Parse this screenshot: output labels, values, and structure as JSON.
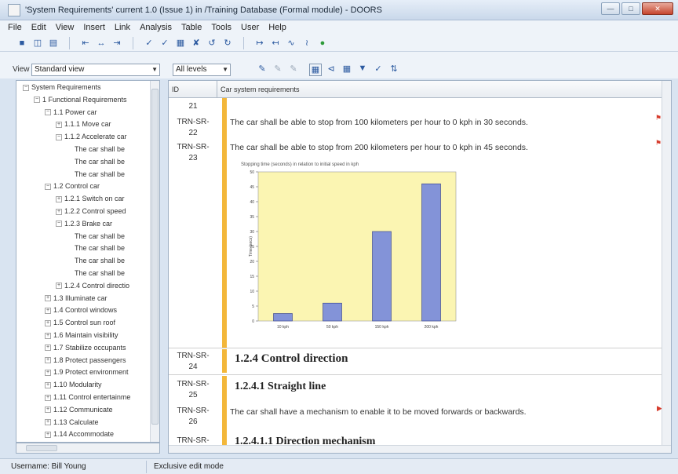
{
  "window": {
    "title": "'System Requirements' current 1.0 (Issue 1) in /Training Database (Formal module) - DOORS"
  },
  "menu": [
    "File",
    "Edit",
    "View",
    "Insert",
    "Link",
    "Analysis",
    "Table",
    "Tools",
    "User",
    "Help"
  ],
  "viewbar": {
    "view_label": "View",
    "view_value": "Standard view",
    "levels_value": "All levels"
  },
  "tree": {
    "items": [
      {
        "label": "System Requirements",
        "toggle": "−"
      },
      {
        "label": "1 Functional Requirements",
        "toggle": "−"
      },
      {
        "label": "1.1 Power car",
        "toggle": "−"
      },
      {
        "label": "1.1.1 Move car",
        "toggle": "+"
      },
      {
        "label": "1.1.2 Accelerate car",
        "toggle": "−"
      },
      {
        "label": "The car shall be",
        "toggle": ""
      },
      {
        "label": "The car shall be",
        "toggle": ""
      },
      {
        "label": "The car shall be",
        "toggle": ""
      },
      {
        "label": "1.2 Control car",
        "toggle": "−"
      },
      {
        "label": "1.2.1 Switch on car",
        "toggle": "+"
      },
      {
        "label": "1.2.2 Control speed",
        "toggle": "+"
      },
      {
        "label": "1.2.3 Brake car",
        "toggle": "−"
      },
      {
        "label": "The car shall be",
        "toggle": ""
      },
      {
        "label": "The car shall be",
        "toggle": ""
      },
      {
        "label": "The car shall be",
        "toggle": ""
      },
      {
        "label": "The car shall be",
        "toggle": ""
      },
      {
        "label": "1.2.4 Control directio",
        "toggle": "+"
      },
      {
        "label": "1.3 Illuminate car",
        "toggle": "+"
      },
      {
        "label": "1.4 Control windows",
        "toggle": "+"
      },
      {
        "label": "1.5 Control sun roof",
        "toggle": "+"
      },
      {
        "label": "1.6 Maintain visibility",
        "toggle": "+"
      },
      {
        "label": "1.7 Stabilize occupants",
        "toggle": "+"
      },
      {
        "label": "1.8 Protect passengers",
        "toggle": "+"
      },
      {
        "label": "1.9 Protect environment",
        "toggle": "+"
      },
      {
        "label": "1.10 Modularity",
        "toggle": "+"
      },
      {
        "label": "1.11 Control entertainme",
        "toggle": "+"
      },
      {
        "label": "1.12 Communicate",
        "toggle": "+"
      },
      {
        "label": "1.13 Calculate",
        "toggle": "+"
      },
      {
        "label": "1.14 Accommodate",
        "toggle": "+"
      }
    ]
  },
  "grid": {
    "col_id": "ID",
    "col_main": "Car system requirements",
    "rows": {
      "r21_id": "21",
      "r22_id": "TRN-SR-\n22",
      "r22_text": "The car shall be able to stop from 100 kilometers per hour to 0 kph in 30 seconds.",
      "r23_id": "TRN-SR-\n23",
      "r23_text": "The car shall be able to stop from 200 kilometers per hour to 0 kph in 45 seconds.",
      "r24_id": "TRN-SR-\n24",
      "r24_text": "1.2.4 Control direction",
      "r25_id": "TRN-SR-\n25",
      "r25_text": "1.2.4.1 Straight line",
      "r26_id": "TRN-SR-\n26",
      "r26_text": "The car shall have a mechanism to enable it to be moved forwards or backwards.",
      "r27_id": "TRN-SR-",
      "r27_text": "1.2.4.1.1 Direction mechanism"
    }
  },
  "chart_data": {
    "type": "bar",
    "title": "Stopping time (seconds) in relation to initial speed in kph",
    "ylabel": "Time (secs)",
    "categories": [
      "10 kph",
      "50 kph",
      "150 kph",
      "200 kph"
    ],
    "values": [
      2.5,
      6,
      30,
      46
    ],
    "ylim": [
      0,
      50
    ],
    "yticks": [
      0,
      5,
      10,
      15,
      20,
      25,
      30,
      35,
      40,
      45,
      50
    ],
    "colors": {
      "plot_bg": "#fbf5b2",
      "bar": "#8393d8",
      "bar_border": "#2d3a86"
    },
    "grid": false
  },
  "status": {
    "username": "Username: Bill Young",
    "mode": "Exclusive edit mode"
  }
}
